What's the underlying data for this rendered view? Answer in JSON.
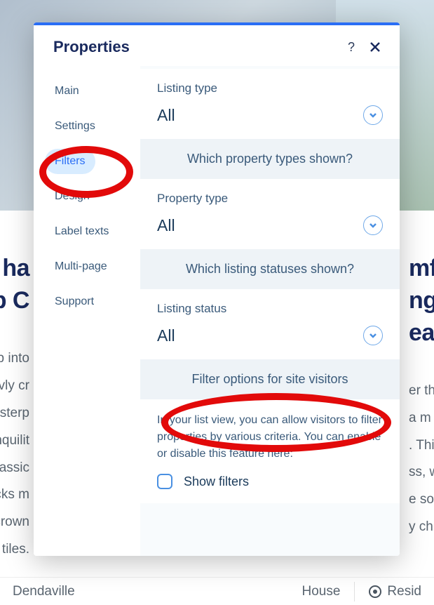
{
  "background": {
    "heading_left": "ha\np C",
    "body_left": "p into\nvly cr\nsterp\nnquilit\nclassic\ncks m\ncrown\nof tiles.",
    "heading_right": "mf\nng\nea",
    "body_right": "er th\na m\n. This\nss, w\ne sof\ny ch",
    "footer_left": "Dendaville",
    "footer_mid": "House",
    "footer_right": "Resid"
  },
  "modal": {
    "title": "Properties",
    "sidebar": {
      "items": [
        {
          "label": "Main",
          "key": "main"
        },
        {
          "label": "Settings",
          "key": "settings"
        },
        {
          "label": "Filters",
          "key": "filters",
          "active": true
        },
        {
          "label": "Design",
          "key": "design"
        },
        {
          "label": "Label texts",
          "key": "label-texts"
        },
        {
          "label": "Multi-page",
          "key": "multi-page"
        },
        {
          "label": "Support",
          "key": "support"
        }
      ]
    },
    "content": {
      "listing_type": {
        "label": "Listing type",
        "value": "All"
      },
      "section1": "Which property types shown?",
      "property_type": {
        "label": "Property type",
        "value": "All"
      },
      "section2": "Which listing statuses shown?",
      "listing_status": {
        "label": "Listing status",
        "value": "All"
      },
      "section3": "Filter options for site visitors",
      "info": "In your list view, you can allow visitors to filter properties by various criteria. You can enable or disable this feature here:",
      "show_filters_label": "Show filters",
      "show_filters_checked": false
    }
  }
}
